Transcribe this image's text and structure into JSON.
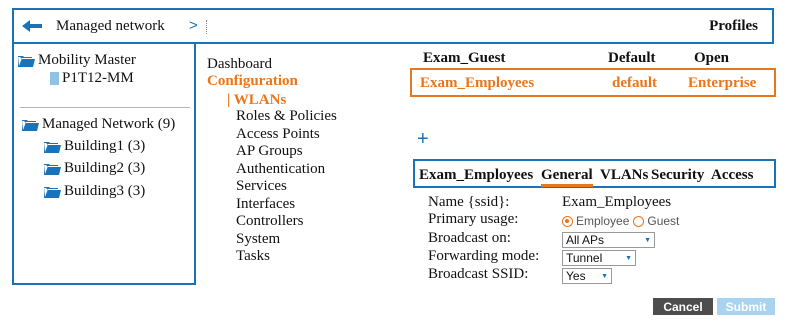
{
  "header": {
    "title": "Managed network",
    "separator": ">",
    "right_label": "Profiles",
    "back_icon": "arrow-left-icon"
  },
  "tree": {
    "mobility_master": "Mobility Master",
    "device": "P1T12-MM",
    "managed_network": "Managed Network (9)",
    "buildings": [
      "Building1 (3)",
      "Building2 (3)",
      "Building3 (3)"
    ]
  },
  "nav": {
    "dashboard": "Dashboard",
    "configuration": "Configuration",
    "wlans": "| WLANs",
    "items": [
      "Roles & Policies",
      "Access Points",
      "AP Groups",
      "Authentication",
      "Services",
      "Interfaces",
      "Controllers",
      "System",
      "Tasks"
    ]
  },
  "profiles": {
    "header_row": {
      "name": "Exam_Guest",
      "type": "Default",
      "auth": "Open"
    },
    "selected_row": {
      "name": "Exam_Employees",
      "type": "default",
      "auth": "Enterprise"
    }
  },
  "add_symbol": "+",
  "tabs": {
    "title": "Exam_Employees",
    "items": [
      "General",
      "VLANs",
      "Security",
      "Access"
    ],
    "active": "General"
  },
  "form": {
    "name_label": "Name {ssid}:",
    "name_value": "Exam_Employees",
    "usage_label": "Primary usage:",
    "usage_options": [
      "Employee",
      "Guest"
    ],
    "usage_selected": "Employee",
    "broadcast_on_label": "Broadcast on:",
    "broadcast_on_value": "All APs",
    "forwarding_label": "Forwarding mode:",
    "forwarding_value": "Tunnel",
    "broadcast_ssid_label": "Broadcast SSID:",
    "broadcast_ssid_value": "Yes"
  },
  "buttons": {
    "cancel": "Cancel",
    "submit": "Submit"
  },
  "colors": {
    "accent_blue": "#1a73b8",
    "accent_orange": "#e8761c",
    "cancel_bg": "#4d4d4d",
    "submit_bg": "#a9d4ef"
  }
}
